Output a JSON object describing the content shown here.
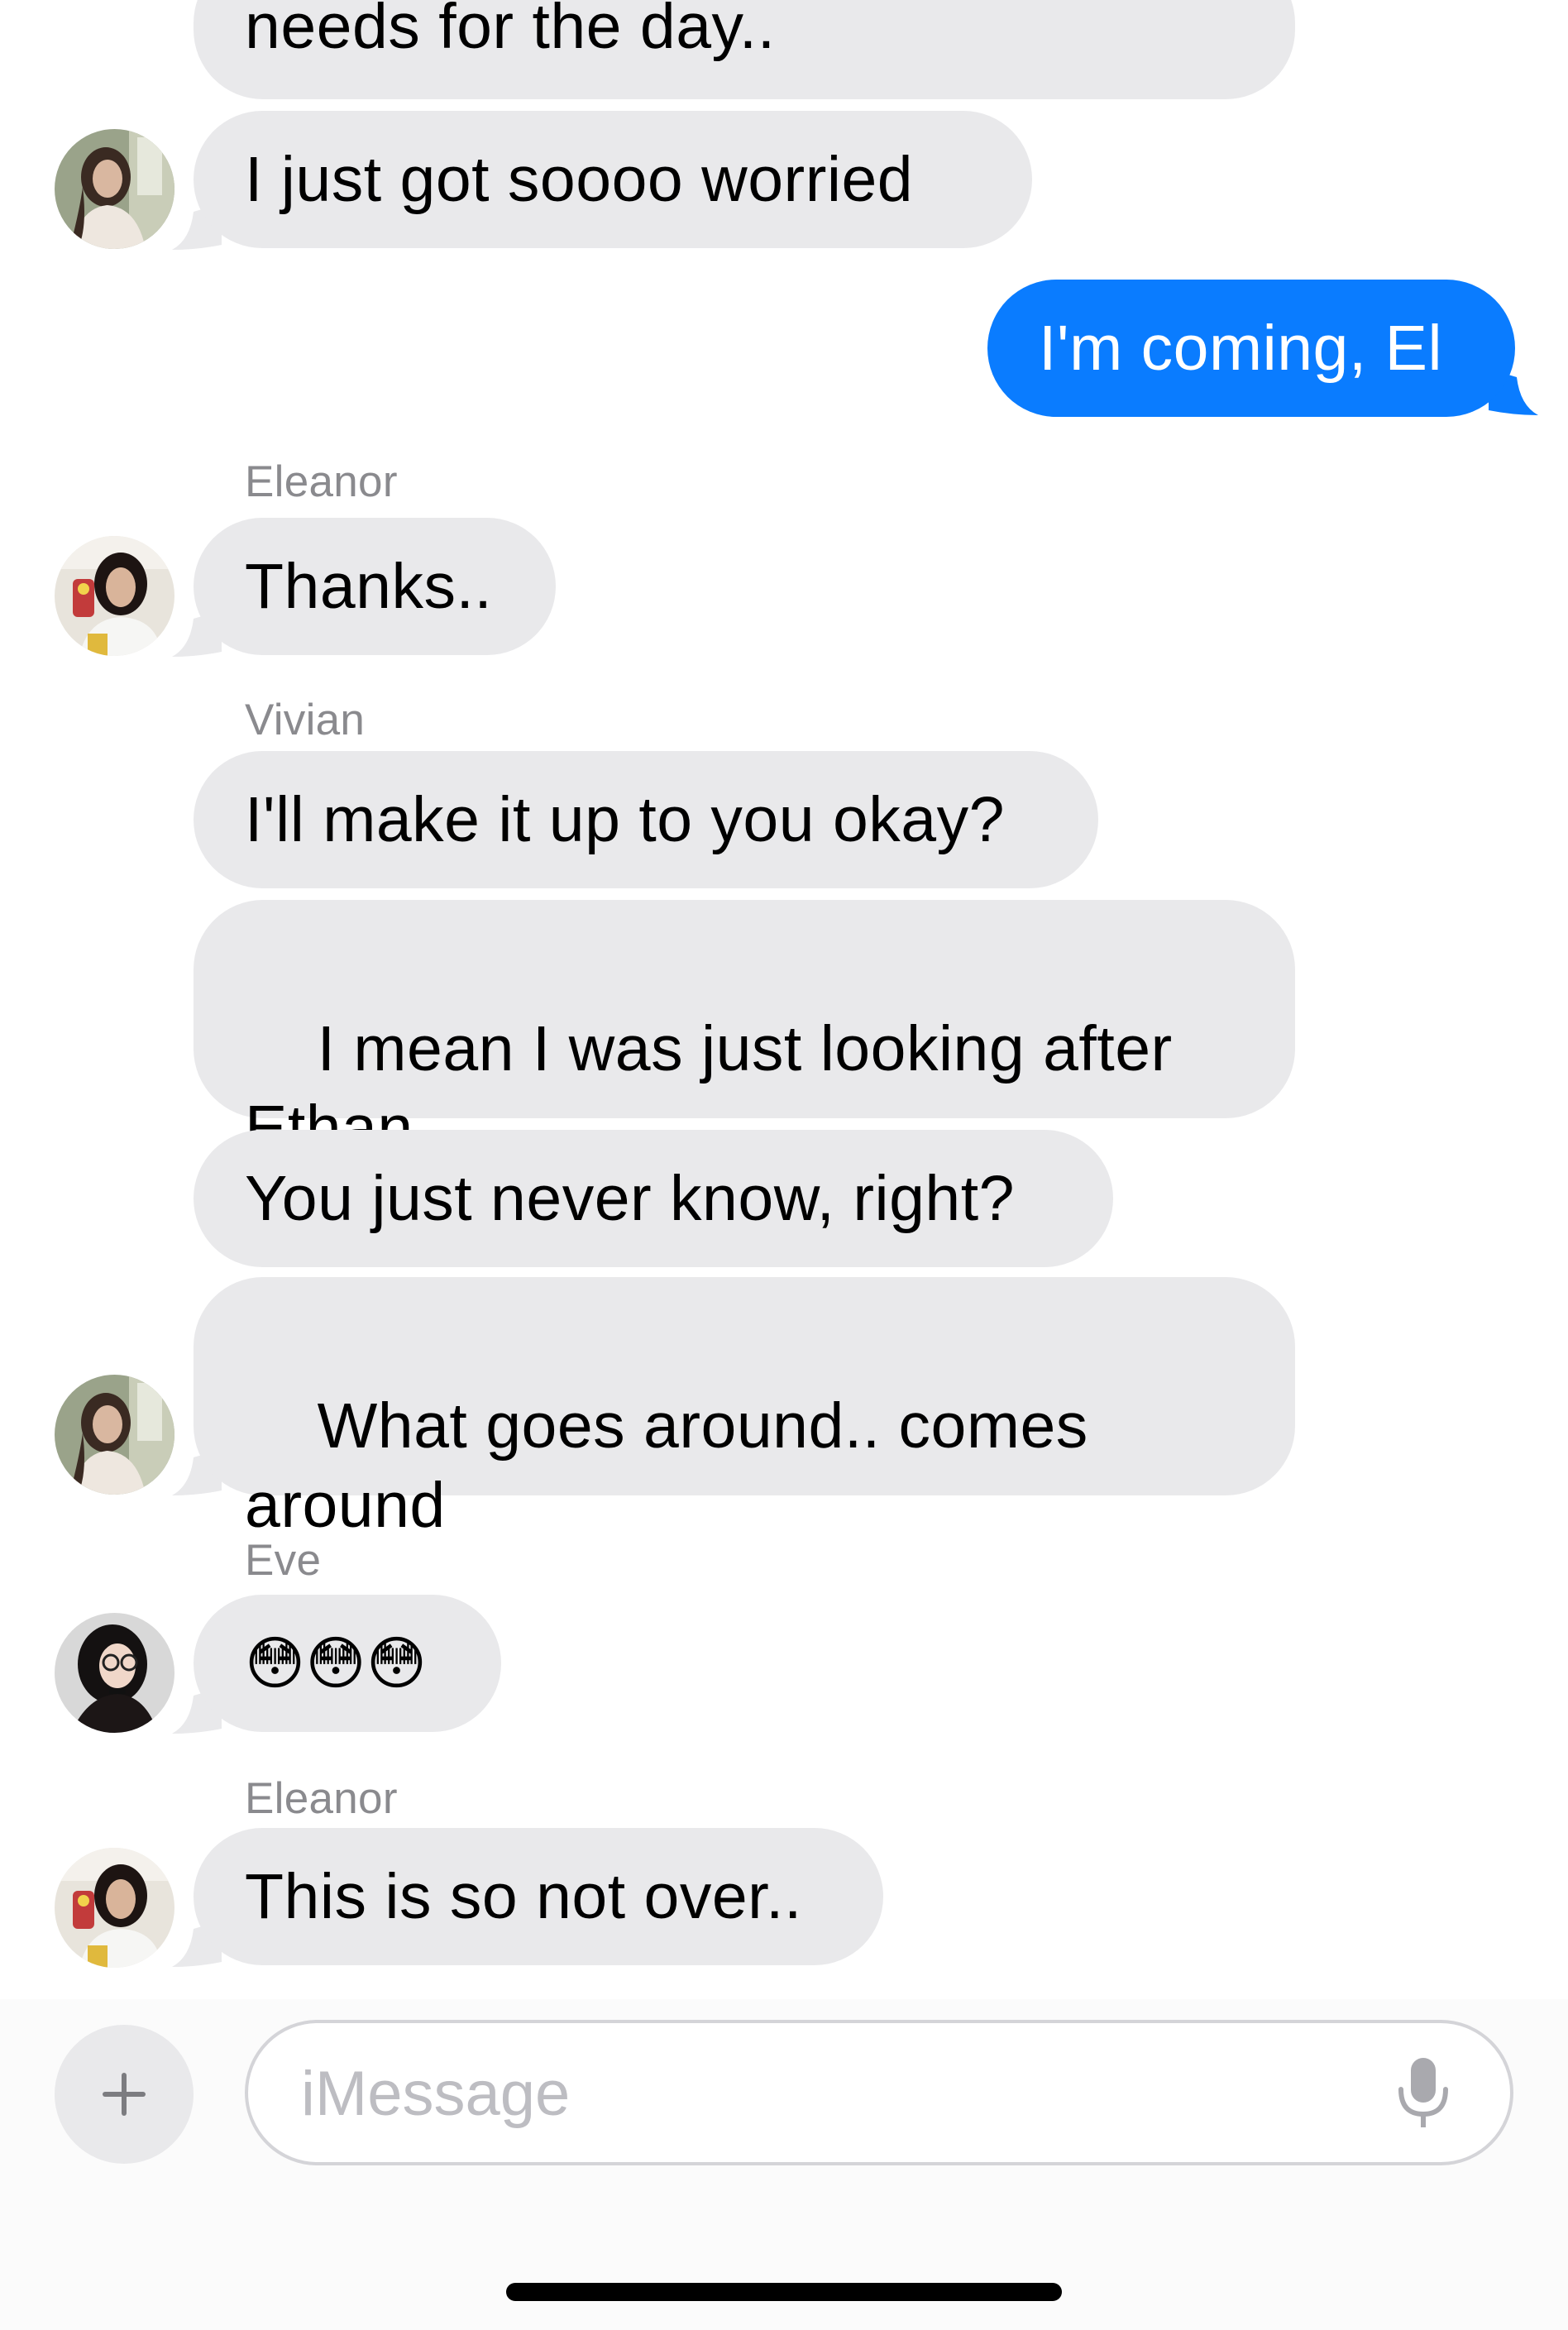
{
  "thread": {
    "messages": [
      {
        "id": "m1",
        "text": "needs for the day..",
        "direction": "incoming"
      },
      {
        "id": "m2",
        "text": "I just got soooo worried",
        "direction": "incoming"
      },
      {
        "id": "m3",
        "text": "I'm coming, El",
        "direction": "outgoing"
      },
      {
        "id": "m4",
        "sender": "Eleanor",
        "text": "Thanks..",
        "direction": "incoming"
      },
      {
        "id": "m5",
        "sender": "Vivian",
        "text": "I'll make it up to you okay?",
        "direction": "incoming"
      },
      {
        "id": "m6",
        "text": "I mean I was just looking after\nEthan",
        "direction": "incoming"
      },
      {
        "id": "m7",
        "text": "You just never know, right?",
        "direction": "incoming"
      },
      {
        "id": "m8",
        "text": "What goes around.. comes\naround",
        "direction": "incoming"
      },
      {
        "id": "m9",
        "sender": "Eve",
        "text": "😳😳😳",
        "direction": "incoming"
      },
      {
        "id": "m10",
        "sender": "Eleanor",
        "text": "This is so not over..",
        "direction": "incoming"
      }
    ]
  },
  "composer": {
    "placeholder": "iMessage",
    "value": "",
    "plus_icon": "plus-icon",
    "mic_icon": "microphone-icon"
  },
  "colors": {
    "incoming_bubble": "#e9e9eb",
    "outgoing_bubble": "#0a7cff",
    "sender_label": "#8a8a8e",
    "placeholder": "#bdbdc2"
  }
}
